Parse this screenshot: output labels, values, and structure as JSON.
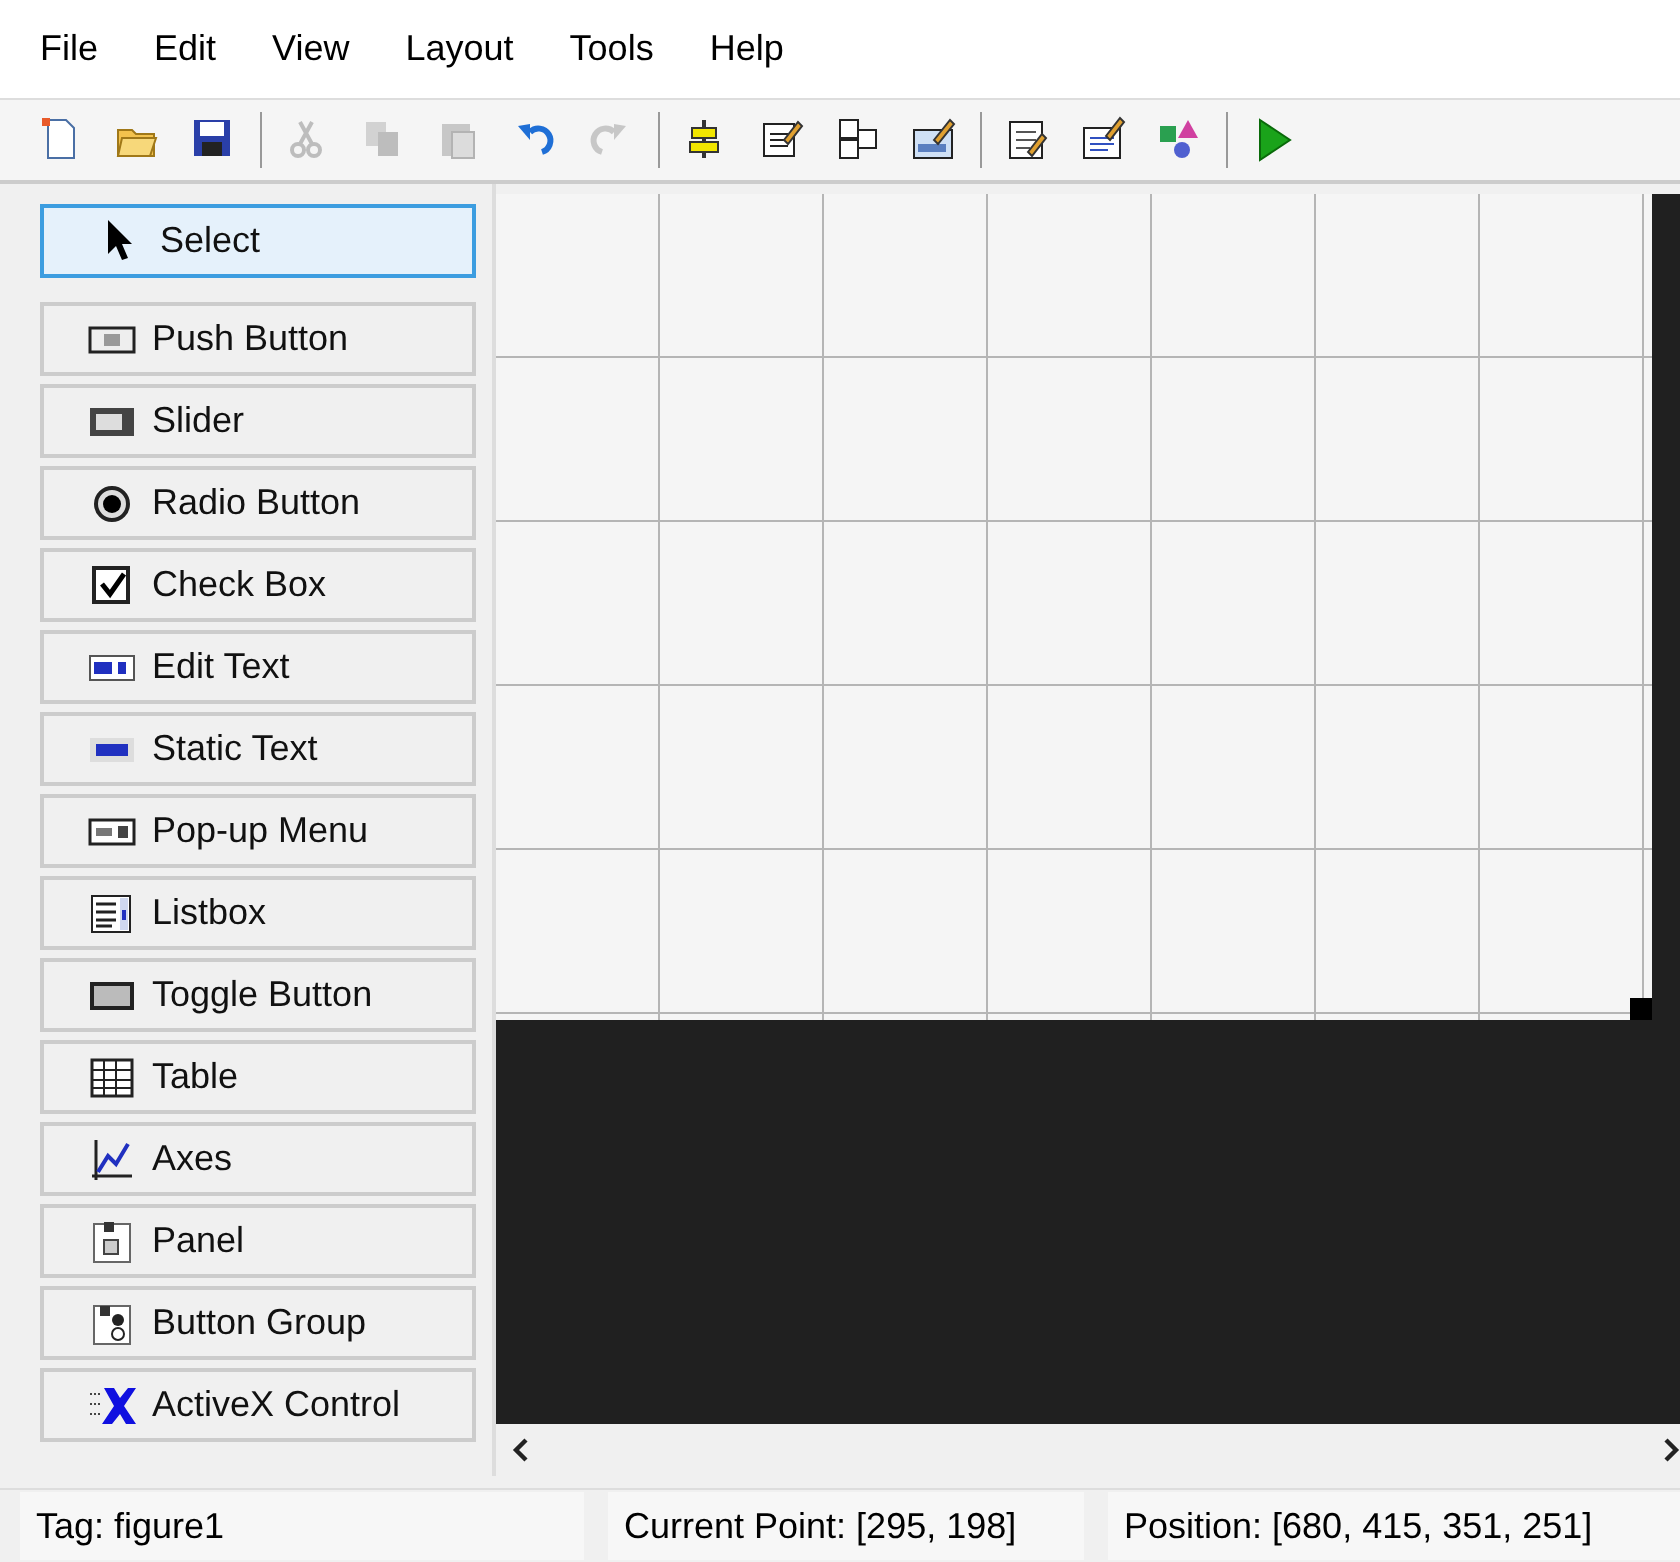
{
  "menu": [
    "File",
    "Edit",
    "View",
    "Layout",
    "Tools",
    "Help"
  ],
  "toolbar": [
    {
      "disabled": false
    },
    {
      "disabled": false
    },
    {
      "disabled": false
    },
    {
      "disabled": true
    },
    {
      "disabled": true
    },
    {
      "disabled": true
    },
    {
      "disabled": false
    },
    {
      "disabled": true
    },
    {
      "disabled": false
    },
    {
      "disabled": false
    },
    {
      "disabled": false
    },
    {
      "disabled": false
    },
    {
      "disabled": false
    },
    {
      "disabled": false
    },
    {
      "disabled": false
    },
    {
      "disabled": false
    }
  ],
  "palette": [
    {
      "label": "Select",
      "selected": true
    },
    {
      "label": "Push Button",
      "selected": false
    },
    {
      "label": "Slider",
      "selected": false
    },
    {
      "label": "Radio Button",
      "selected": false
    },
    {
      "label": "Check Box",
      "selected": false
    },
    {
      "label": "Edit Text",
      "selected": false
    },
    {
      "label": "Static Text",
      "selected": false
    },
    {
      "label": "Pop-up Menu",
      "selected": false
    },
    {
      "label": "Listbox",
      "selected": false
    },
    {
      "label": "Toggle Button",
      "selected": false
    },
    {
      "label": "Table",
      "selected": false
    },
    {
      "label": "Axes",
      "selected": false
    },
    {
      "label": "Panel",
      "selected": false
    },
    {
      "label": "Button Group",
      "selected": false
    },
    {
      "label": "ActiveX Control",
      "selected": false
    }
  ],
  "status_bar": [
    "Tag: figure1",
    "Current Point:  [295, 198]",
    "Position: [680, 415, 351, 251]"
  ]
}
